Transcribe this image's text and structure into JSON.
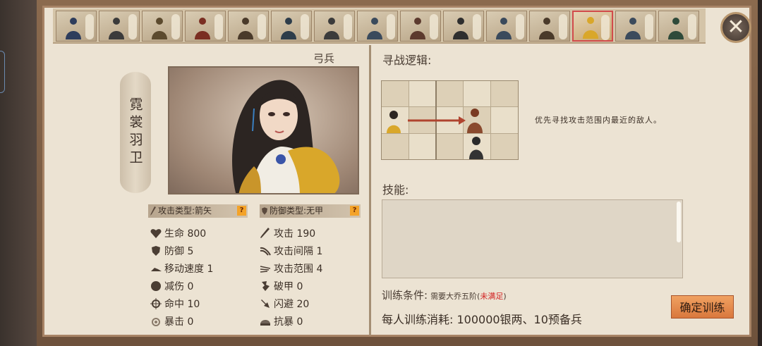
{
  "unit_bar": {
    "units": [
      {
        "name": "",
        "selected": false
      },
      {
        "name": "",
        "selected": false
      },
      {
        "name": "",
        "selected": false
      },
      {
        "name": "",
        "selected": false
      },
      {
        "name": "",
        "selected": false
      },
      {
        "name": "",
        "selected": false
      },
      {
        "name": "",
        "selected": false
      },
      {
        "name": "",
        "selected": false
      },
      {
        "name": "",
        "selected": false
      },
      {
        "name": "",
        "selected": false
      },
      {
        "name": "",
        "selected": false
      },
      {
        "name": "",
        "selected": false
      },
      {
        "name": "",
        "selected": true
      },
      {
        "name": "",
        "selected": false
      },
      {
        "name": "",
        "selected": false
      }
    ]
  },
  "close_label": "✕",
  "unit": {
    "name": "霓裳羽卫",
    "type": "弓兵",
    "attack_type": "攻击类型:箭矢",
    "defense_type": "防御类型:无甲",
    "help": "?"
  },
  "stats": {
    "hp": "生命 800",
    "defense": "防御 5",
    "move_speed": "移动速度 1",
    "damage_reduction": "减伤 0",
    "accuracy": "命中 10",
    "crit": "暴击 0",
    "attack": "攻击 190",
    "attack_interval": "攻击间隔 1",
    "attack_range": "攻击范围 4",
    "armor_break": "破甲 0",
    "dodge": "闪避 20",
    "crit_resist": "抗暴 0"
  },
  "logic": {
    "title": "寻战逻辑:",
    "description": "优先寻找攻击范围内最近的敌人。"
  },
  "skills": {
    "title": "技能:"
  },
  "training": {
    "condition_label": "训练条件:",
    "requirement": "需要大乔五阶(",
    "unmet": "未满足",
    "close_paren": ")",
    "cost": "每人训练消耗: 100000银两、10预备兵",
    "confirm": "确定训练"
  },
  "colors": {
    "panel_bg": "#ece3d3",
    "accent_button": "#e58b4c",
    "unmet_red": "#d22222",
    "selected_border": "#d14b4b"
  }
}
